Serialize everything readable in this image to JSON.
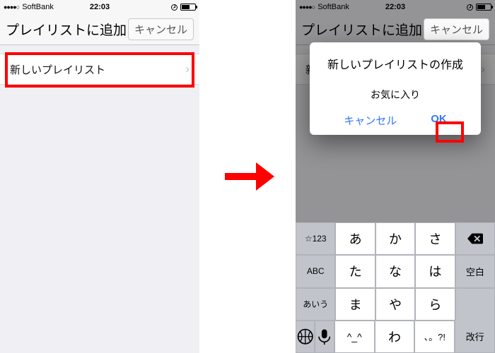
{
  "status": {
    "dots": "●●●●○",
    "carrier": "SoftBank",
    "time": "22:03"
  },
  "nav": {
    "title": "プレイリストに追加",
    "cancel": "キャンセル"
  },
  "row": {
    "label": "新しいプレイリスト",
    "chevron": "›"
  },
  "dialog": {
    "title": "新しいプレイリストの作成",
    "input_value": "お気に入り",
    "cancel": "キャンセル",
    "ok": "OK"
  },
  "keyboard": {
    "rows": [
      [
        "☆123",
        "あ",
        "か",
        "さ",
        "DEL"
      ],
      [
        "ABC",
        "た",
        "な",
        "は",
        "空白"
      ],
      [
        "あいう",
        "ま",
        "や",
        "ら",
        "改行"
      ],
      [
        "GLOBEMIC",
        "^_^",
        "わ",
        "、。?!",
        ""
      ]
    ],
    "labels": {
      "space": "空白",
      "return": "改行",
      "num": "☆123",
      "abc": "ABC",
      "kana": "あいう",
      "face": "^_^",
      "wa": "わ",
      "punct": "、。?!"
    }
  }
}
